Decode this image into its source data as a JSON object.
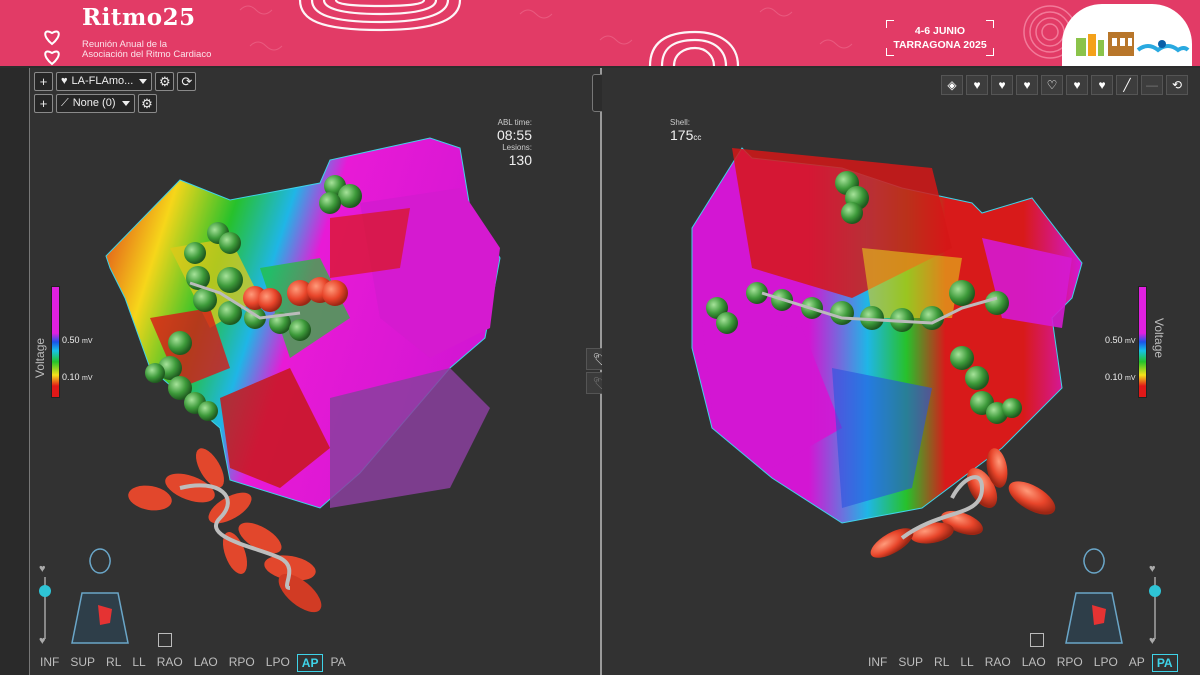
{
  "banner": {
    "title": "Ritmo25",
    "subtitle_line1": "Reunión Anual de la",
    "subtitle_line2": "Asociación del Ritmo Cardiaco",
    "date_line1": "4-6 JUNIO",
    "date_line2": "TARRAGONA 2025",
    "color": "#e23b66"
  },
  "left_panel": {
    "map_dropdown": "LA-FLAmo...",
    "points_dropdown": "None (0)",
    "abl_time_label": "ABL time:",
    "abl_time_value": "08:55",
    "lesions_label": "Lesions:",
    "lesions_value": "130",
    "voltage_label": "Voltage",
    "scale_high": "0.50",
    "scale_low": "0.10",
    "scale_unit": "mV",
    "views": [
      "INF",
      "SUP",
      "RL",
      "LL",
      "RAO",
      "LAO",
      "RPO",
      "LPO",
      "AP",
      "PA"
    ],
    "active_view": "AP"
  },
  "right_panel": {
    "shell_label": "Shell:",
    "shell_value": "175",
    "shell_unit": "cc",
    "voltage_label": "Voltage",
    "scale_high": "0.50",
    "scale_low": "0.10",
    "scale_unit": "mV",
    "views": [
      "INF",
      "SUP",
      "RL",
      "LL",
      "RAO",
      "LAO",
      "RPO",
      "LPO",
      "AP",
      "PA"
    ],
    "active_view": "PA"
  },
  "icons": {
    "plus": "+",
    "heart": "♥",
    "gear": "⚙",
    "catheter": "⟋"
  },
  "colors": {
    "accent": "#3fd3e8",
    "scale_magenta": "#e020e0",
    "scale_red": "#e01818"
  }
}
